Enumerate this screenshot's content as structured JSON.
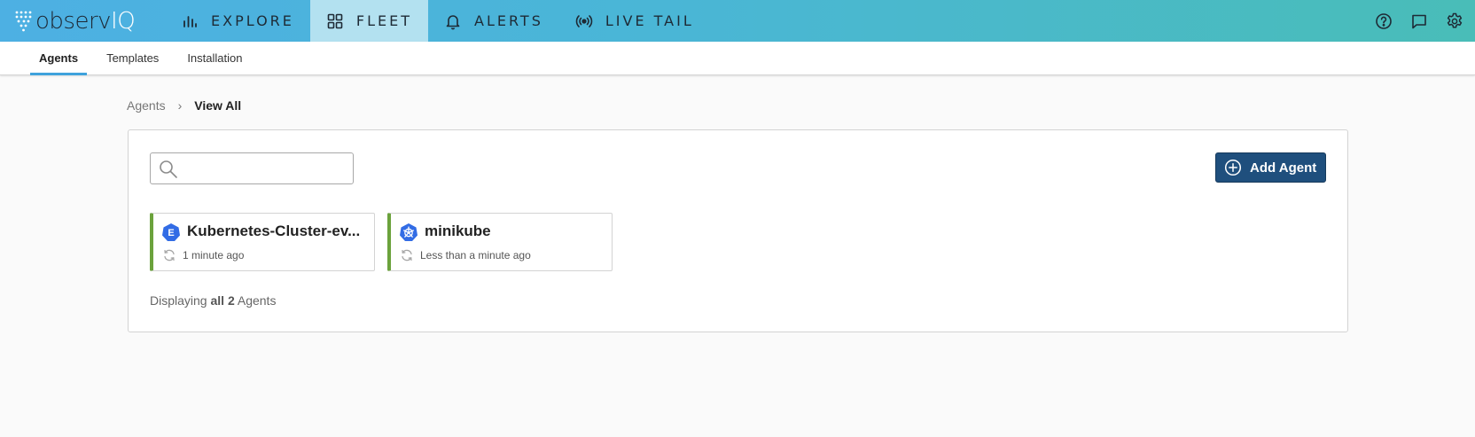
{
  "brand": {
    "name_part1": "observ",
    "name_part2": "IQ"
  },
  "nav": {
    "items": [
      {
        "label": "EXPLORE",
        "icon": "bar-chart-icon"
      },
      {
        "label": "FLEET",
        "icon": "grid-icon"
      },
      {
        "label": "ALERTS",
        "icon": "bell-icon"
      },
      {
        "label": "LIVE TAIL",
        "icon": "broadcast-icon"
      }
    ],
    "active": "FLEET",
    "right_icons": [
      "help-icon",
      "chat-icon",
      "settings-icon"
    ]
  },
  "subtabs": {
    "items": [
      "Agents",
      "Templates",
      "Installation"
    ],
    "active": "Agents"
  },
  "breadcrumb": {
    "parent": "Agents",
    "separator": "›",
    "current": "View All"
  },
  "search": {
    "value": "",
    "placeholder": ""
  },
  "add_button": {
    "label": "Add Agent"
  },
  "agents": [
    {
      "name": "Kubernetes-Cluster-ev...",
      "icon_letter": "E",
      "status": "1 minute ago",
      "status_color": "#6ba23c"
    },
    {
      "name": "minikube",
      "icon_letter": "",
      "status": "Less than a minute ago",
      "status_color": "#6ba23c"
    }
  ],
  "summary": {
    "prefix": "Displaying",
    "count": "all 2",
    "suffix": "Agents"
  },
  "colors": {
    "accent": "#3fa2dc",
    "button": "#1f4f7d",
    "agent_icon": "#326ce5",
    "status_ok": "#6ba23c"
  }
}
